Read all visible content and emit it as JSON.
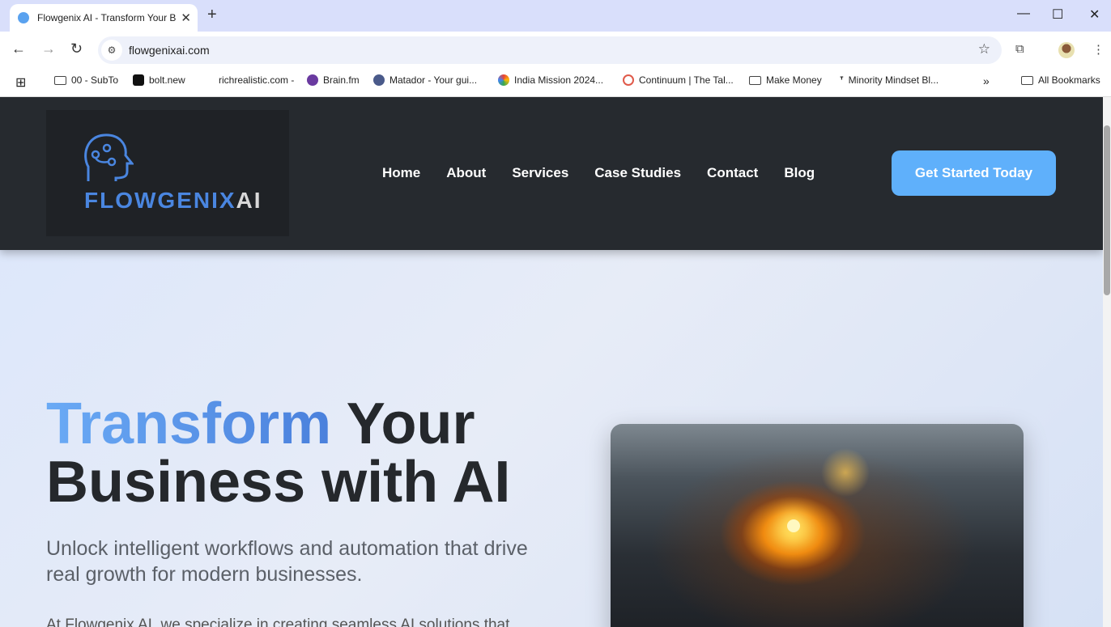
{
  "browser": {
    "tab_title": "Flowgenix AI - Transform Your B",
    "url": "flowgenixai.com",
    "bookmarks": [
      "00 - SubTo",
      "bolt.new",
      "richrealistic.com -",
      "Brain.fm",
      "Matador - Your gui...",
      "India Mission 2024...",
      "Continuum | The Tal...",
      "Make Money",
      "Minority Mindset Bl..."
    ],
    "all_bookmarks": "All Bookmarks"
  },
  "site": {
    "logo_main": "FLOWGENIX",
    "logo_accent": "AI",
    "nav": [
      "Home",
      "About",
      "Services",
      "Case Studies",
      "Contact",
      "Blog"
    ],
    "cta": "Get Started Today",
    "hero": {
      "title_accent": "Transform",
      "title_rest": " Your",
      "title_line2": "Business with AI",
      "subtitle": "Unlock intelligent workflows and automation that drive real growth for modern businesses.",
      "paragraph": "At Flowgenix AI, we specialize in creating seamless AI solutions that"
    }
  },
  "colors": {
    "accent": "#5fb0fb",
    "header": "#262a2f",
    "logo_blue": "#4a86e0"
  }
}
